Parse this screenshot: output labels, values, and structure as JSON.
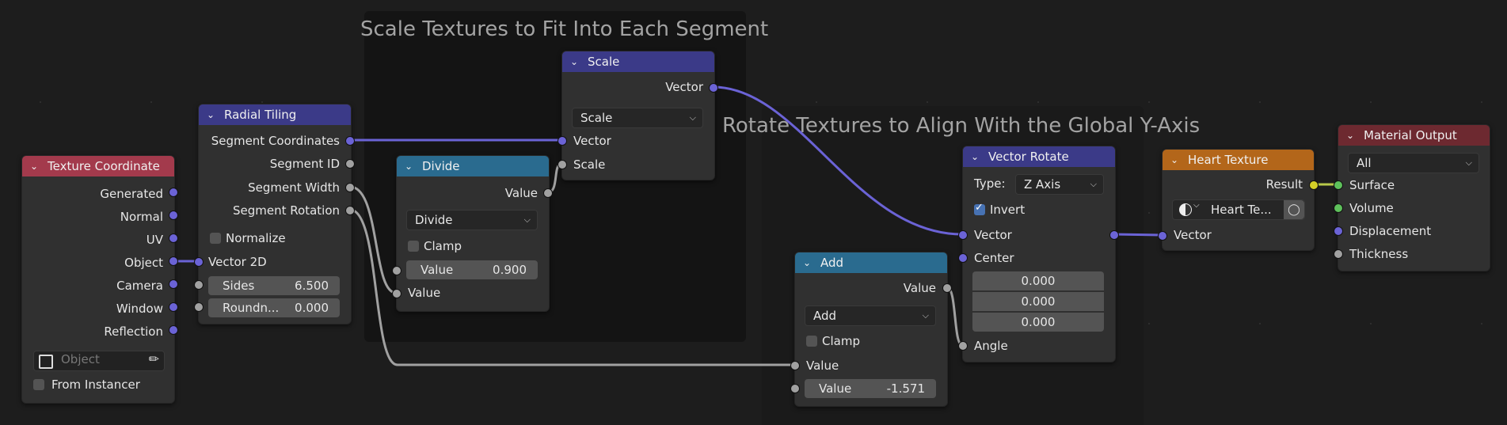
{
  "frames": {
    "scale": {
      "title": "Scale Textures to Fit Into Each Segment"
    },
    "rotate": {
      "title": "Rotate Textures to Align With the Global Y-Axis"
    }
  },
  "colors": {
    "background": "#1d1d1d",
    "node_body": "#303030",
    "input_header": "#a33a4c",
    "converter_header": "#3b3a88",
    "math_header": "#2a6b8f",
    "texture_header": "#b3661a",
    "output_header": "#6d2930",
    "socket_vector": "#6b63d6",
    "socket_float": "#a1a1a1",
    "socket_color": "#d4cf27",
    "socket_shader": "#5ec15b",
    "checkbox_on": "#4772b3"
  },
  "nodes": {
    "texture_coordinate": {
      "title": "Texture Coordinate",
      "outputs": [
        "Generated",
        "Normal",
        "UV",
        "Object",
        "Camera",
        "Window",
        "Reflection"
      ],
      "object_placeholder": "Object",
      "from_instancer": "From Instancer",
      "object_icon": "cube-icon",
      "eyedropper_icon": "eyedropper-icon"
    },
    "radial_tiling": {
      "title": "Radial Tiling",
      "outputs": [
        "Segment Coordinates",
        "Segment ID",
        "Segment Width",
        "Segment Rotation"
      ],
      "normalize": "Normalize",
      "input_vector": "Vector 2D",
      "sides_label": "Sides",
      "sides_value": "6.500",
      "roundness_label": "Roundn...",
      "roundness_value": "0.000"
    },
    "divide": {
      "title": "Divide",
      "output": "Value",
      "operation": "Divide",
      "clamp": "Clamp",
      "value_label": "Value",
      "value_value": "0.900",
      "input": "Value"
    },
    "scale": {
      "title": "Scale",
      "output": "Vector",
      "operation": "Scale",
      "input_vector": "Vector",
      "input_scale": "Scale"
    },
    "add": {
      "title": "Add",
      "output": "Value",
      "operation": "Add",
      "clamp": "Clamp",
      "input": "Value",
      "value_label": "Value",
      "value_value": "-1.571"
    },
    "vector_rotate": {
      "title": "Vector Rotate",
      "type_label": "Type:",
      "type_value": "Z Axis",
      "invert": "Invert",
      "input_vector": "Vector",
      "input_center": "Center",
      "center_x": "0.000",
      "center_y": "0.000",
      "center_z": "0.000",
      "input_angle": "Angle"
    },
    "heart_texture": {
      "title": "Heart Texture",
      "output": "Result",
      "group_name": "Heart Te...",
      "input_vector": "Vector",
      "sphere_icon": "node-group-icon",
      "shield_icon": "fake-user-shield-icon"
    },
    "material_output": {
      "title": "Material Output",
      "target": "All",
      "inputs": [
        "Surface",
        "Volume",
        "Displacement",
        "Thickness"
      ]
    }
  }
}
